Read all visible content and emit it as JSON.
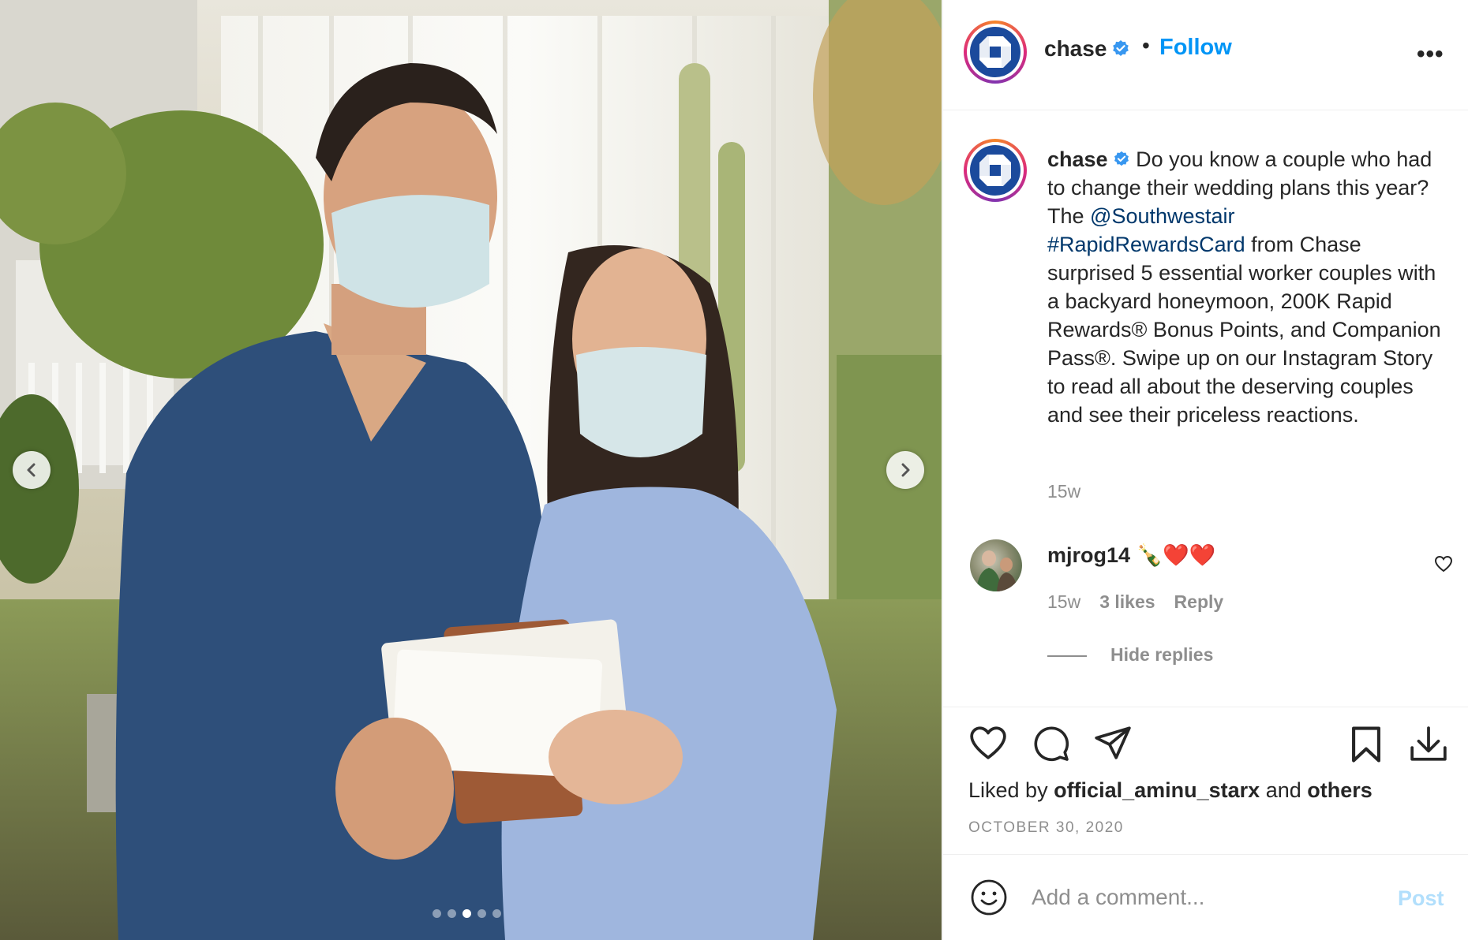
{
  "post": {
    "username": "chase",
    "follow_label": "Follow",
    "separator": "•",
    "more_label": "•••",
    "image_dots": {
      "count": 5,
      "active_index": 2
    }
  },
  "caption": {
    "username": "chase",
    "text_before": " Do you know a couple who had to change their wedding plans this year? The ",
    "mention": "@Southwestair",
    "hashtag": "#RapidRewardsCard",
    "text_after": " from Chase surprised 5 essential worker couples with a backyard honeymoon, 200K Rapid Rewards® Bonus Points, and Companion Pass®. Swipe up on our Instagram Story to read all about the deserving couples and see their priceless reactions.",
    "time": "15w"
  },
  "comment": {
    "username": "mjrog14",
    "text": "🍾❤️❤️",
    "time": "15w",
    "likes": "3 likes",
    "reply_label": "Reply",
    "hide_replies_label": "Hide replies"
  },
  "actions": {
    "liked_prefix": "Liked by ",
    "liked_user": "official_aminu_starx",
    "liked_and": " and ",
    "liked_others": "others",
    "date": "OCTOBER 30, 2020"
  },
  "comment_box": {
    "placeholder": "Add a comment...",
    "post_label": "Post"
  },
  "icons": {
    "verified": "verified-badge-icon",
    "like": "heart-icon",
    "comment": "comment-bubble-icon",
    "share": "paper-plane-icon",
    "save": "bookmark-icon",
    "download": "download-icon",
    "emoji": "smiley-icon"
  },
  "colors": {
    "accent": "#0095f6",
    "link": "#00376b",
    "muted": "#8e8e8e",
    "chase_blue": "#1b4a9c",
    "post_disabled": "#b2dffc"
  }
}
